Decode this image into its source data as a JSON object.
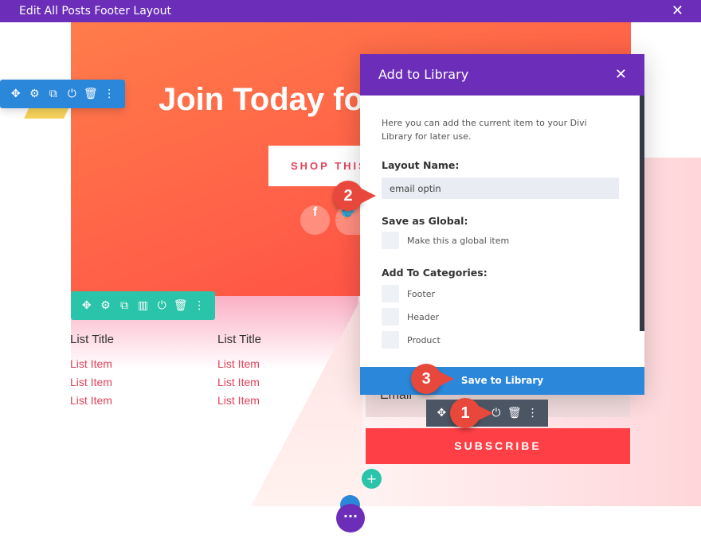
{
  "window": {
    "title": "Edit All Posts Footer Layout",
    "close_icon": "close-icon"
  },
  "hero": {
    "headline": "Join Today for",
    "button": "SHOP THIS",
    "social": [
      "f",
      "t"
    ]
  },
  "lists": [
    {
      "title": "List Title",
      "items": [
        "List Item",
        "List Item",
        "List Item"
      ]
    },
    {
      "title": "List Title",
      "items": [
        "List Item",
        "List Item",
        "List Item"
      ]
    }
  ],
  "form": {
    "email_placeholder": "Email",
    "subscribe": "SUBSCRIBE"
  },
  "modal": {
    "title": "Add to Library",
    "description": "Here you can add the current item to your Divi Library for later use.",
    "layout_name_label": "Layout Name:",
    "layout_name_value": "email optin",
    "global_label": "Save as Global:",
    "global_option": "Make this a global item",
    "categories_label": "Add To Categories:",
    "categories": [
      "Footer",
      "Header",
      "Product"
    ],
    "save_button": "Save to Library"
  },
  "callouts": [
    "1",
    "2",
    "3"
  ],
  "colors": {
    "purple": "#6c2eb9",
    "blue": "#2b87da",
    "green": "#29c4a9",
    "red": "#ff3f46"
  }
}
